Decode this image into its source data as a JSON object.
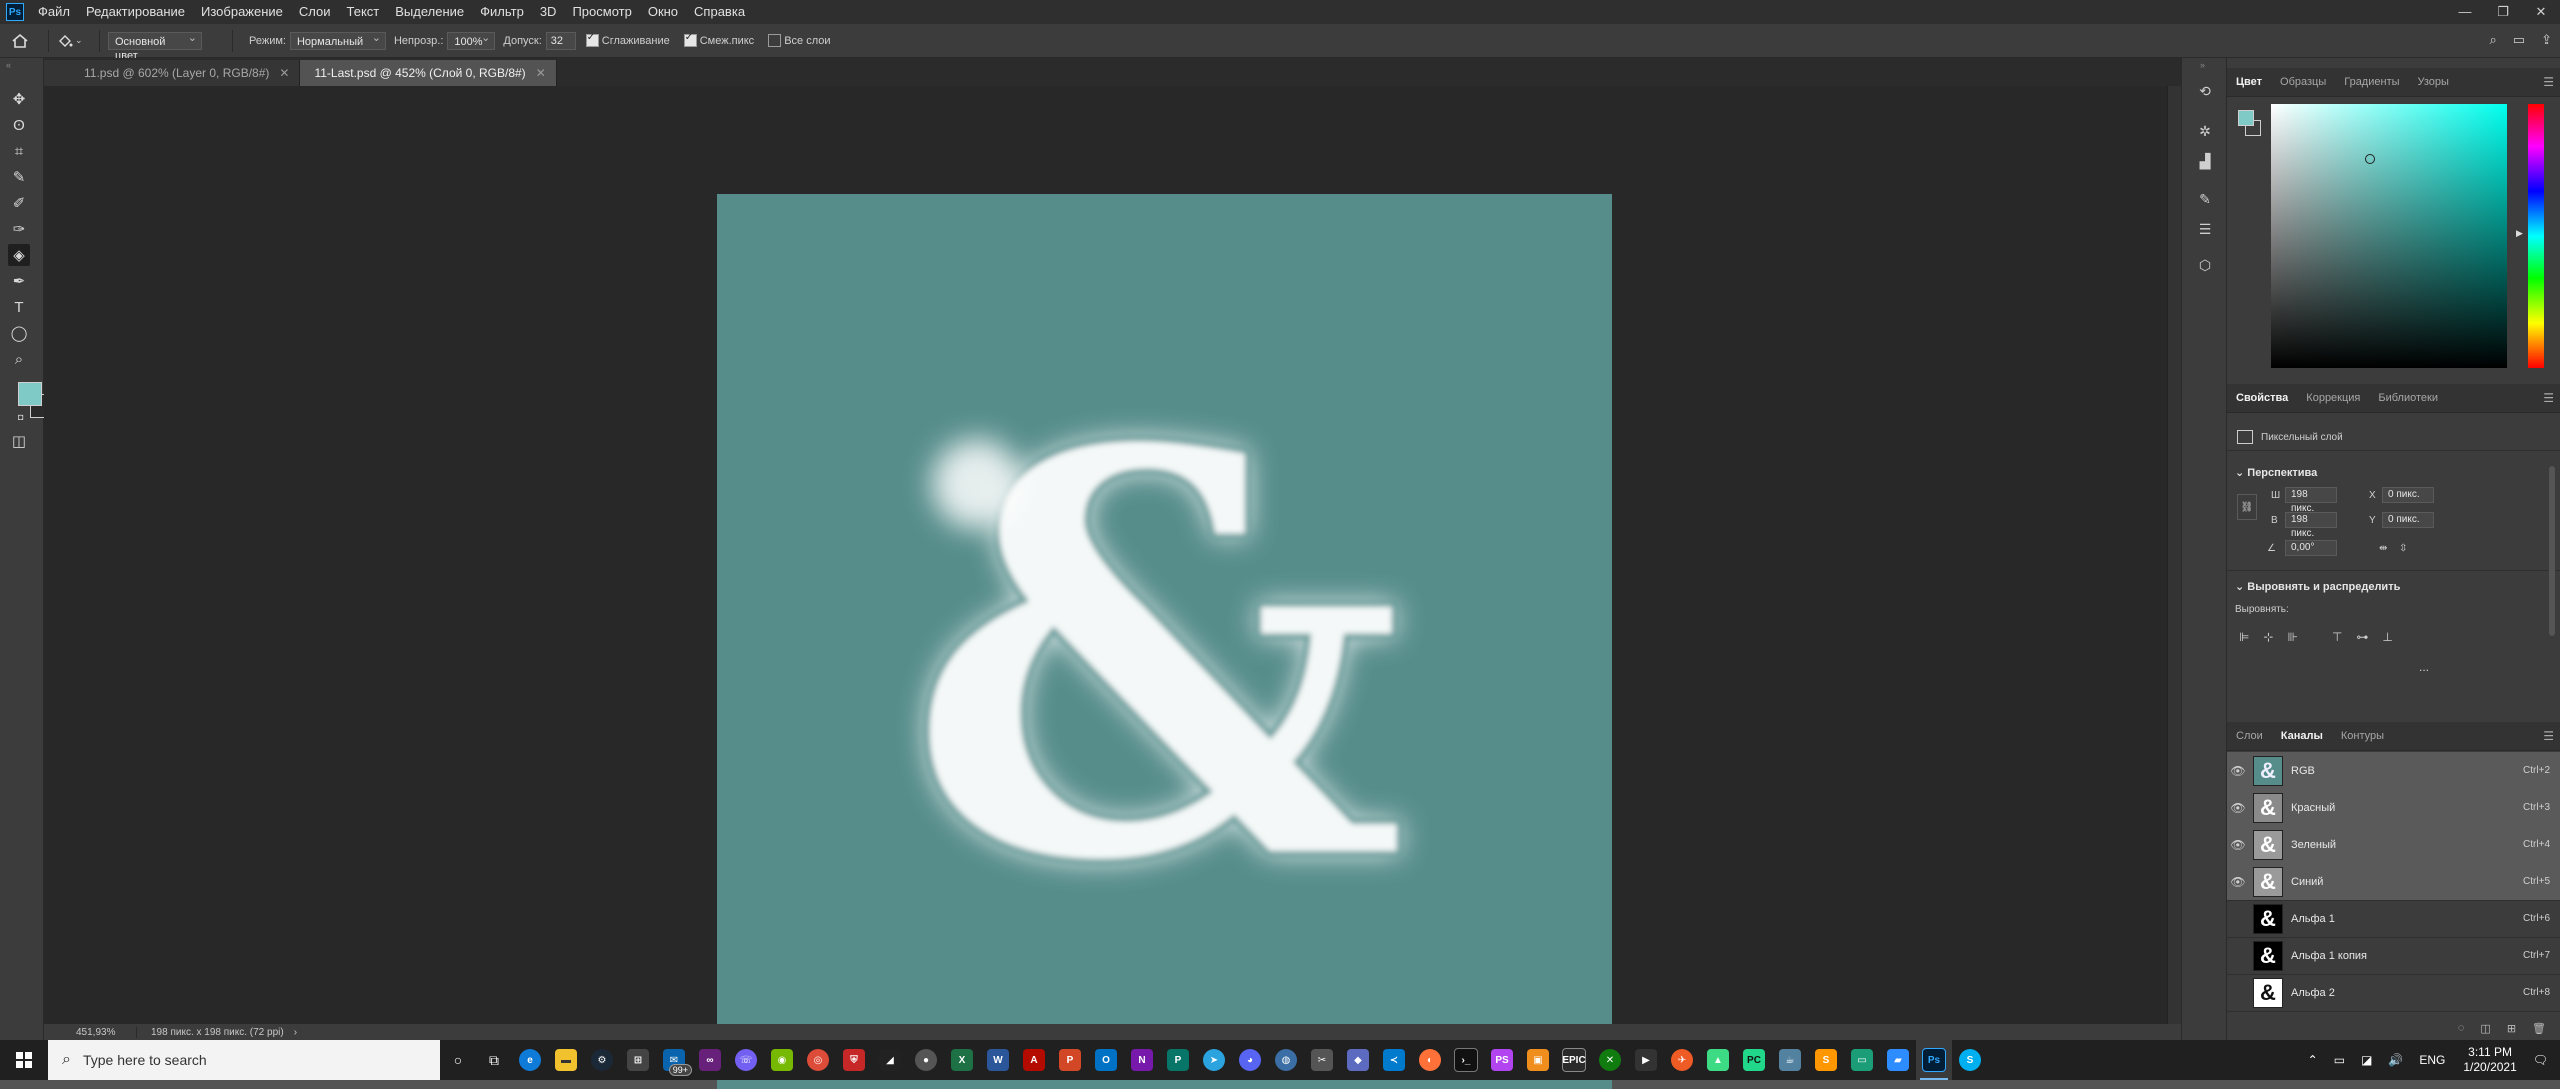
{
  "menu": {
    "app_icon": "Ps",
    "items": [
      "Файл",
      "Редактирование",
      "Изображение",
      "Слои",
      "Текст",
      "Выделение",
      "Фильтр",
      "3D",
      "Просмотр",
      "Окно",
      "Справка"
    ],
    "window_controls": [
      "—",
      "❐",
      "✕"
    ]
  },
  "options_bar": {
    "fill_source": "Основной цвет",
    "mode_label": "Режим:",
    "mode_value": "Нормальный",
    "opacity_label": "Непрозр.:",
    "opacity_value": "100%",
    "tolerance_label": "Допуск:",
    "tolerance_value": "32",
    "antialias_label": "Сглаживание",
    "antialias_checked": true,
    "contiguous_label": "Смеж.пикс",
    "contiguous_checked": true,
    "all_layers_label": "Все слои",
    "all_layers_checked": false
  },
  "tabs": [
    {
      "label": "11.psd @ 602% (Layer 0, RGB/8#)",
      "close": "✕",
      "active": false
    },
    {
      "label": "11-Last.psd @ 452% (Слой 0, RGB/8#)",
      "close": "✕",
      "active": true
    }
  ],
  "canvas": {
    "background": "#568d8b",
    "glyph": "&"
  },
  "status": {
    "zoom": "451,93%",
    "info": "198 пикс. x 198 пикс. (72 ppi)",
    "arrow": "›"
  },
  "color_panel": {
    "tabs": [
      "Цвет",
      "Образцы",
      "Градиенты",
      "Узоры"
    ],
    "foreground": "#7fc9c6",
    "background_color": "#3c3c3c",
    "hue_color": "#00ffee"
  },
  "properties_panel": {
    "tabs": [
      "Свойства",
      "Коррекция",
      "Библиотеки"
    ],
    "layer_type": "Пиксельный слой",
    "section_transform": "Перспектива",
    "w_label": "Ш",
    "w_value": "198 пикс.",
    "h_label": "В",
    "h_value": "198 пикс.",
    "x_label": "X",
    "x_value": "0 пикс.",
    "y_label": "Y",
    "y_value": "0 пикс.",
    "angle_value": "0,00°",
    "section_align": "Выровнять и распределить",
    "align_label": "Выровнять:",
    "more": "..."
  },
  "channels_panel": {
    "tabs": [
      "Слои",
      "Каналы",
      "Контуры"
    ],
    "rows": [
      {
        "name": "RGB",
        "shortcut": "Ctrl+2",
        "visible": true,
        "selected": true,
        "thumb": "&",
        "thumb_style": "teal"
      },
      {
        "name": "Красный",
        "shortcut": "Ctrl+3",
        "visible": true,
        "selected": true,
        "thumb": "&",
        "thumb_style": "gray"
      },
      {
        "name": "Зеленый",
        "shortcut": "Ctrl+4",
        "visible": true,
        "selected": true,
        "thumb": "&",
        "thumb_style": "gray"
      },
      {
        "name": "Синий",
        "shortcut": "Ctrl+5",
        "visible": true,
        "selected": true,
        "thumb": "&",
        "thumb_style": "gray"
      },
      {
        "name": "Альфа 1",
        "shortcut": "Ctrl+6",
        "visible": false,
        "selected": false,
        "thumb": "&",
        "thumb_style": "black"
      },
      {
        "name": "Альфа 1 копия",
        "shortcut": "Ctrl+7",
        "visible": false,
        "selected": false,
        "thumb": "&",
        "thumb_style": "black"
      },
      {
        "name": "Альфа 2",
        "shortcut": "Ctrl+8",
        "visible": false,
        "selected": false,
        "thumb": "&",
        "thumb_style": "white"
      }
    ]
  },
  "taskbar": {
    "search_placeholder": "Type here to search",
    "badge": "99+",
    "language": "ENG",
    "time": "3:11 PM",
    "date": "1/20/2021"
  }
}
